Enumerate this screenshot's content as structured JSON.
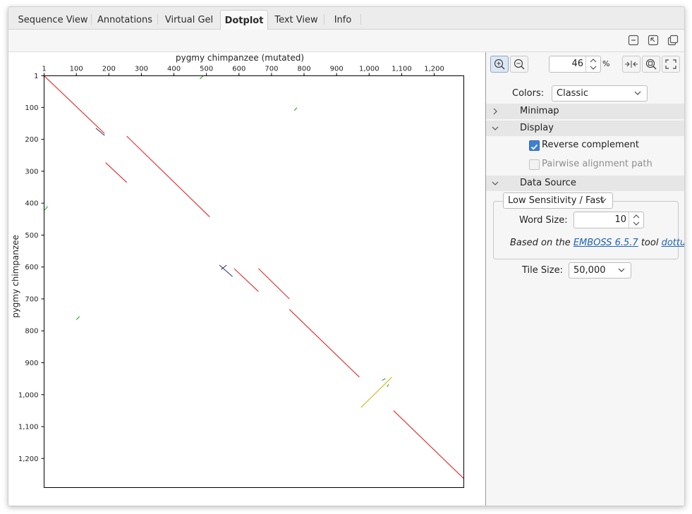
{
  "tabs": [
    {
      "label": "Sequence View",
      "active": false
    },
    {
      "label": "Annotations",
      "active": false
    },
    {
      "label": "Virtual Gel",
      "active": false
    },
    {
      "label": "Dotplot",
      "active": true
    },
    {
      "label": "Text View",
      "active": false
    },
    {
      "label": "Info",
      "active": false
    }
  ],
  "toolbar": {
    "icons": [
      "collapse-panel-icon",
      "restore-panel-icon",
      "undock-window-icon"
    ]
  },
  "dotplot": {
    "x_title": "pygmy chimpanzee (mutated)",
    "y_title": "pygmy chimpanzee",
    "x_ticks": [
      "1",
      "100",
      "200",
      "300",
      "400",
      "500",
      "600",
      "700",
      "800",
      "900",
      "1,000",
      "1,100",
      "1,200"
    ],
    "y_ticks": [
      "1",
      "100",
      "200",
      "300",
      "400",
      "500",
      "600",
      "700",
      "800",
      "900",
      "1,000",
      "1,100",
      "1,200"
    ],
    "max_length": 1290,
    "colors": {
      "forward": "#e01010",
      "reverse": "#1a9a1a",
      "other": "#2d2d6e",
      "overlap": "#c8b400"
    },
    "segments": [
      {
        "x1": 1,
        "y1": 1,
        "x2": 187,
        "y2": 182,
        "color": "forward"
      },
      {
        "x1": 160,
        "y1": 165,
        "x2": 187,
        "y2": 188,
        "color": "other"
      },
      {
        "x1": 255,
        "y1": 190,
        "x2": 510,
        "y2": 443,
        "color": "forward"
      },
      {
        "x1": 190,
        "y1": 273,
        "x2": 255,
        "y2": 335,
        "color": "forward"
      },
      {
        "x1": 540,
        "y1": 594,
        "x2": 580,
        "y2": 630,
        "color": "other"
      },
      {
        "x1": 545,
        "y1": 608,
        "x2": 562,
        "y2": 594,
        "color": "other"
      },
      {
        "x1": 585,
        "y1": 605,
        "x2": 660,
        "y2": 677,
        "color": "forward"
      },
      {
        "x1": 660,
        "y1": 605,
        "x2": 755,
        "y2": 700,
        "color": "forward"
      },
      {
        "x1": 755,
        "y1": 733,
        "x2": 970,
        "y2": 945,
        "color": "forward"
      },
      {
        "x1": 975,
        "y1": 1040,
        "x2": 1070,
        "y2": 945,
        "color": "overlap"
      },
      {
        "x1": 1040,
        "y1": 955,
        "x2": 1050,
        "y2": 950,
        "color": "reverse"
      },
      {
        "x1": 1055,
        "y1": 975,
        "x2": 1060,
        "y2": 968,
        "color": "reverse"
      },
      {
        "x1": 1075,
        "y1": 1050,
        "x2": 1290,
        "y2": 1262,
        "color": "forward"
      },
      {
        "x1": 480,
        "y1": 11,
        "x2": 490,
        "y2": 1,
        "color": "reverse"
      },
      {
        "x1": 770,
        "y1": 110,
        "x2": 778,
        "y2": 101,
        "color": "reverse"
      },
      {
        "x1": 3,
        "y1": 422,
        "x2": 12,
        "y2": 410,
        "color": "reverse"
      },
      {
        "x1": 100,
        "y1": 765,
        "x2": 110,
        "y2": 755,
        "color": "reverse"
      }
    ]
  },
  "side": {
    "zoom_value": "46",
    "zoom_unit": "%",
    "colors_label": "Colors:",
    "colors_value": "Classic",
    "minimap_label": "Minimap",
    "display_label": "Display",
    "reverse_complement_label": "Reverse complement",
    "reverse_complement_checked": true,
    "pairwise_label": "Pairwise alignment path",
    "pairwise_checked": false,
    "data_source_label": "Data Source",
    "sensitivity_value": "Low Sensitivity / Fast",
    "word_size_label": "Word Size:",
    "word_size_value": "10",
    "based_prefix": "Based on the",
    "emboss_link": "EMBOSS 6.5.7",
    "based_middle": "tool",
    "dottup_link": "dottup",
    "based_suffix": ".",
    "tile_size_label": "Tile Size:",
    "tile_size_value": "50,000"
  }
}
